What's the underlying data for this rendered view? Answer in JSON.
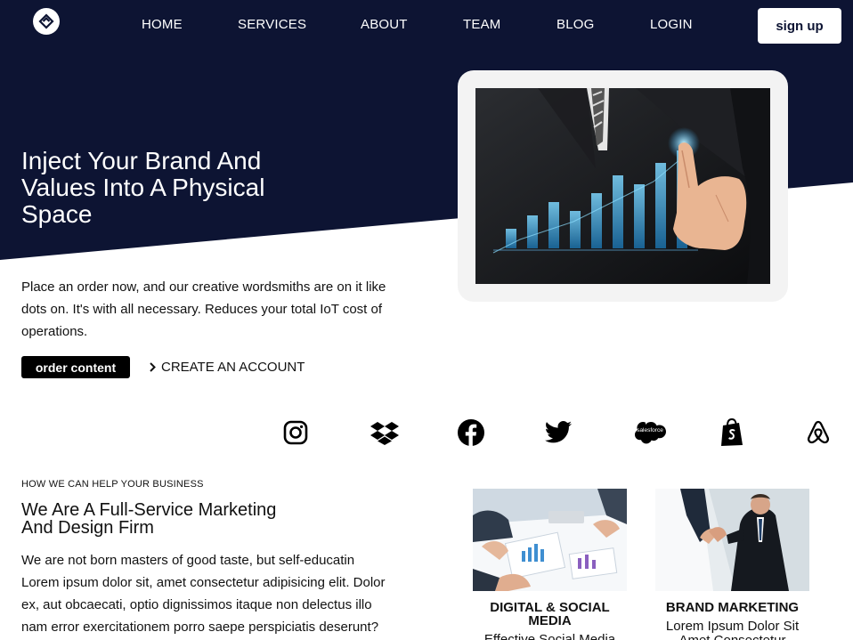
{
  "nav": {
    "items": [
      "HOME",
      "SERVICES",
      "ABOUT",
      "TEAM",
      "BLOG",
      "LOGIN"
    ],
    "signup_label": "sign up"
  },
  "hero": {
    "title": "Inject Your Brand And Values Into A Physical Space",
    "description": "Place an order now, and our creative wordsmiths are on it like dots on. It's with all necessary. Reduces your total IoT cost of operations.",
    "order_label": "order content",
    "create_label": "CREATE AN ACCOUNT"
  },
  "social": [
    "instagram-icon",
    "dropbox-icon",
    "facebook-icon",
    "twitter-icon",
    "salesforce-icon",
    "shopify-icon",
    "airbnb-icon"
  ],
  "salesforce_text": "salesforce",
  "services": {
    "eyebrow": "HOW WE CAN HELP YOUR BUSINESS",
    "title": "We Are A Full-Service Marketing And Design Firm",
    "description": "We are not born masters of good taste, but self-educatin Lorem ipsum dolor sit, amet consectetur adipisicing elit. Dolor ex, aut obcaecati, optio dignissimos itaque non delectus illo nam error exercitationem porro saepe perspiciatis deserunt?",
    "cards": [
      {
        "title": "DIGITAL & SOCIAL MEDIA",
        "subtitle": "Effective Social Media"
      },
      {
        "title": "BRAND MARKETING",
        "subtitle": "Lorem Ipsum Dolor Sit Amet Consectetur"
      }
    ]
  },
  "colors": {
    "navy": "#0d1433",
    "white": "#ffffff",
    "black": "#000000",
    "frame": "#f3f3f3"
  }
}
